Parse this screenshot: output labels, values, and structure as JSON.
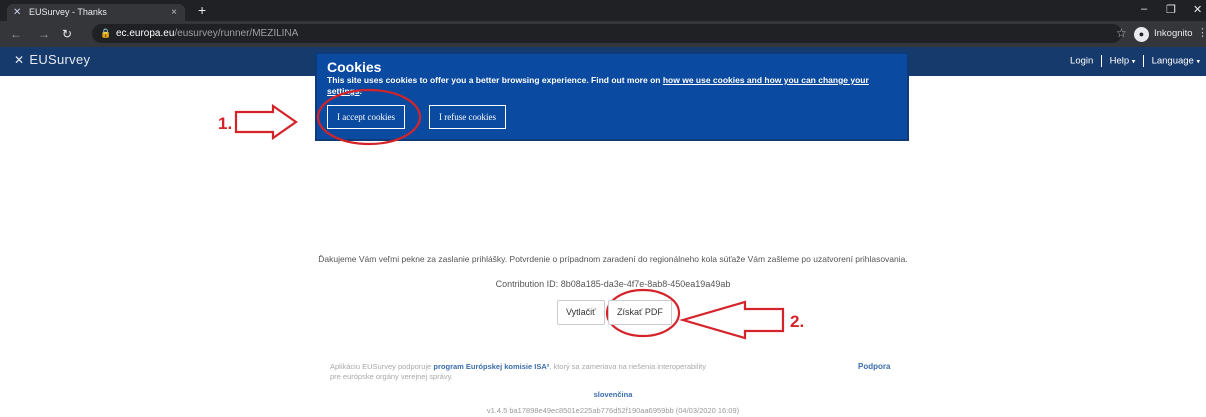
{
  "browser": {
    "tab_title": "EUSurvey - Thanks",
    "tab_close": "×",
    "new_tab": "+",
    "url_host": "ec.europa.eu",
    "url_path": "/eusurvey/runner/MEZILINA",
    "incognito_label": "Inkognito"
  },
  "site_header": {
    "logo_text": "EUSurvey",
    "login": "Login",
    "help": "Help",
    "language": "Language"
  },
  "cookie_banner": {
    "title": "Cookies",
    "text": "This site uses cookies to offer you a better browsing experience. Find out more on",
    "link": "how we use cookies and how you can change your settings",
    "text_end": ".",
    "accept_label": "I accept cookies",
    "refuse_label": "I refuse cookies"
  },
  "annotations": {
    "step1": "1.",
    "step2": "2.",
    "color": "#d4242a"
  },
  "main": {
    "thanks_text": "Ďakujeme Vám veľmi pekne za zaslanie prihlášky. Potvrdenie o prípadnom zaradení do regionálneho kola súťaže Vám zašleme po uzatvorení prihlasovania.",
    "contribution_label": "Contribution ID:",
    "contribution_id": "8b08a185-da3e-4f7e-8ab8-450ea19a49ab",
    "print_button": "Vytlačiť",
    "pdf_button": "Získať PDF"
  },
  "footer": {
    "text_before": "Aplikáciu EUSurvey podporuje",
    "link": "program Európskej komisie ISA²",
    "text_after": ", ktorý sa zameriava na riešenia interoperability pre európske orgány verejnej správy.",
    "support": "Podpora",
    "language": "slovenčina",
    "version": "v1.4.5 ba17898e49ec8501e225ab776d52f190aa6959bb (04/03/2020 16:09)"
  },
  "colors": {
    "header_bg": "#173a6c",
    "banner_bg": "#0a4aa1"
  }
}
